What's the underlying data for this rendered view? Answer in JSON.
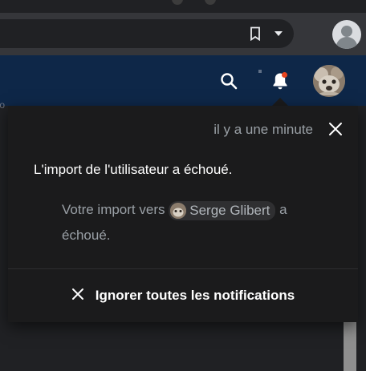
{
  "browser": {
    "icons": [
      "bookmark-icon",
      "dropdown-icon",
      "profile-icon"
    ]
  },
  "header": {
    "icons": [
      "search-icon",
      "bell-icon",
      "avatar"
    ],
    "notification_dot_color": "#e8451f",
    "background_color": "#0e2748"
  },
  "notification": {
    "time": "il y a une minute",
    "title": "L'import de l'utilisateur a échoué.",
    "body_before": "Votre import vers",
    "user_name": "Serge Glibert",
    "body_after": "a échoué."
  },
  "footer": {
    "dismiss_all_label": "Ignorer toutes les notifications"
  }
}
